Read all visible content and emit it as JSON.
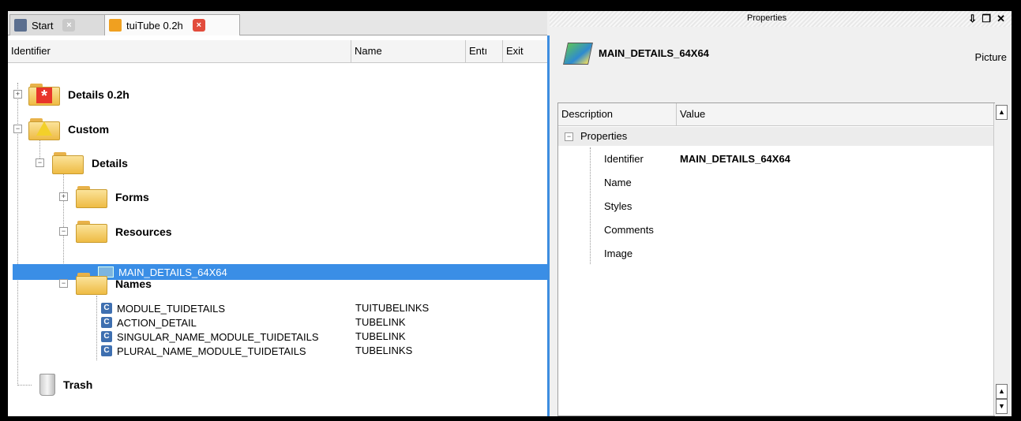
{
  "tabs": [
    {
      "label": "Start"
    },
    {
      "label": "tuiTube 0.2h"
    }
  ],
  "tree": {
    "columns": [
      "Identifier",
      "Name",
      "Entı",
      "Exit"
    ],
    "nodes": {
      "details02h": "Details 0.2h",
      "custom": "Custom",
      "details": "Details",
      "forms": "Forms",
      "resources": "Resources",
      "selected": "MAIN_DETAILS_64X64",
      "names": "Names",
      "trash": "Trash"
    },
    "names_items": [
      {
        "id": "MODULE_TUIDETAILS",
        "name": "TUITUBELINKS"
      },
      {
        "id": "ACTION_DETAIL",
        "name": "TUBELINK"
      },
      {
        "id": "SINGULAR_NAME_MODULE_TUIDETAILS",
        "name": "TUBELINK"
      },
      {
        "id": "PLURAL_NAME_MODULE_TUIDETAILS",
        "name": "TUBELINKS"
      }
    ]
  },
  "properties_panel": {
    "title": "Properties",
    "item_name": "MAIN_DETAILS_64X64",
    "item_type": "Picture",
    "columns": [
      "Description",
      "Value"
    ],
    "group": "Properties",
    "rows": [
      {
        "key": "Identifier",
        "value": "MAIN_DETAILS_64X64"
      },
      {
        "key": "Name",
        "value": ""
      },
      {
        "key": "Styles",
        "value": ""
      },
      {
        "key": "Comments",
        "value": ""
      },
      {
        "key": "Image",
        "value": ""
      }
    ]
  },
  "colors": {
    "selection": "#3a8ee6",
    "accent_border": "#3d8de0",
    "close_red": "#e24c3c"
  }
}
